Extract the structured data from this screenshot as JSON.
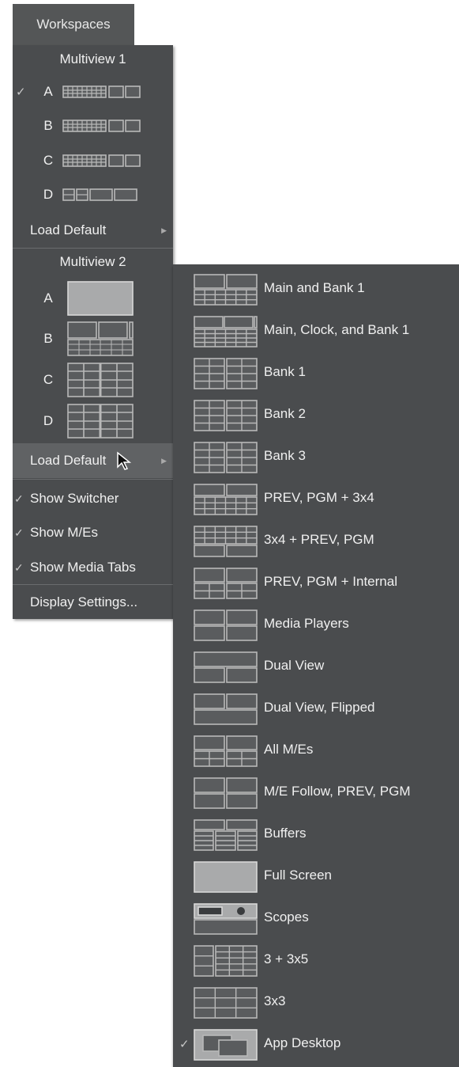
{
  "workspaces_tab": "Workspaces",
  "mv1": {
    "title": "Multiview 1",
    "layouts": [
      {
        "letter": "A",
        "checked": true
      },
      {
        "letter": "B",
        "checked": false
      },
      {
        "letter": "C",
        "checked": false
      },
      {
        "letter": "D",
        "checked": false
      }
    ],
    "load_default": "Load Default"
  },
  "mv2": {
    "title": "Multiview 2",
    "layouts": [
      {
        "letter": "A"
      },
      {
        "letter": "B"
      },
      {
        "letter": "C"
      },
      {
        "letter": "D"
      }
    ],
    "load_default": "Load Default"
  },
  "toggles": {
    "show_switcher": "Show Switcher",
    "show_mes": "Show M/Es",
    "show_media_tabs": "Show Media Tabs"
  },
  "display_settings": "Display Settings...",
  "check_glyph": "✓",
  "submenu": [
    {
      "label": "Main and Bank 1",
      "icon": "main-bank-icon"
    },
    {
      "label": "Main, Clock, and Bank 1",
      "icon": "main-clock-bank-icon"
    },
    {
      "label": "Bank 1",
      "icon": "bank-icon"
    },
    {
      "label": "Bank 2",
      "icon": "bank-icon"
    },
    {
      "label": "Bank 3",
      "icon": "bank-icon"
    },
    {
      "label": "PREV, PGM + 3x4",
      "icon": "prev-pgm-3x4-icon"
    },
    {
      "label": "3x4 + PREV, PGM",
      "icon": "3x4-prev-pgm-icon"
    },
    {
      "label": "PREV, PGM + Internal",
      "icon": "prev-pgm-internal-icon"
    },
    {
      "label": "Media Players",
      "icon": "media-players-icon"
    },
    {
      "label": "Dual View",
      "icon": "dual-view-icon"
    },
    {
      "label": "Dual View, Flipped",
      "icon": "dual-view-flipped-icon"
    },
    {
      "label": "All M/Es",
      "icon": "all-mes-icon"
    },
    {
      "label": "M/E Follow, PREV, PGM",
      "icon": "me-follow-icon"
    },
    {
      "label": "Buffers",
      "icon": "buffers-icon"
    },
    {
      "label": "Full Screen",
      "icon": "full-screen-icon"
    },
    {
      "label": "Scopes",
      "icon": "scopes-icon"
    },
    {
      "label": "3 + 3x5",
      "icon": "3-plus-3x5-icon"
    },
    {
      "label": "3x3",
      "icon": "3x3-icon"
    },
    {
      "label": "App Desktop",
      "icon": "app-desktop-icon",
      "checked": true
    }
  ],
  "colors": {
    "menu_bg": "#4a4c4e",
    "highlight": "#606264",
    "text": "#f0f0f0"
  }
}
